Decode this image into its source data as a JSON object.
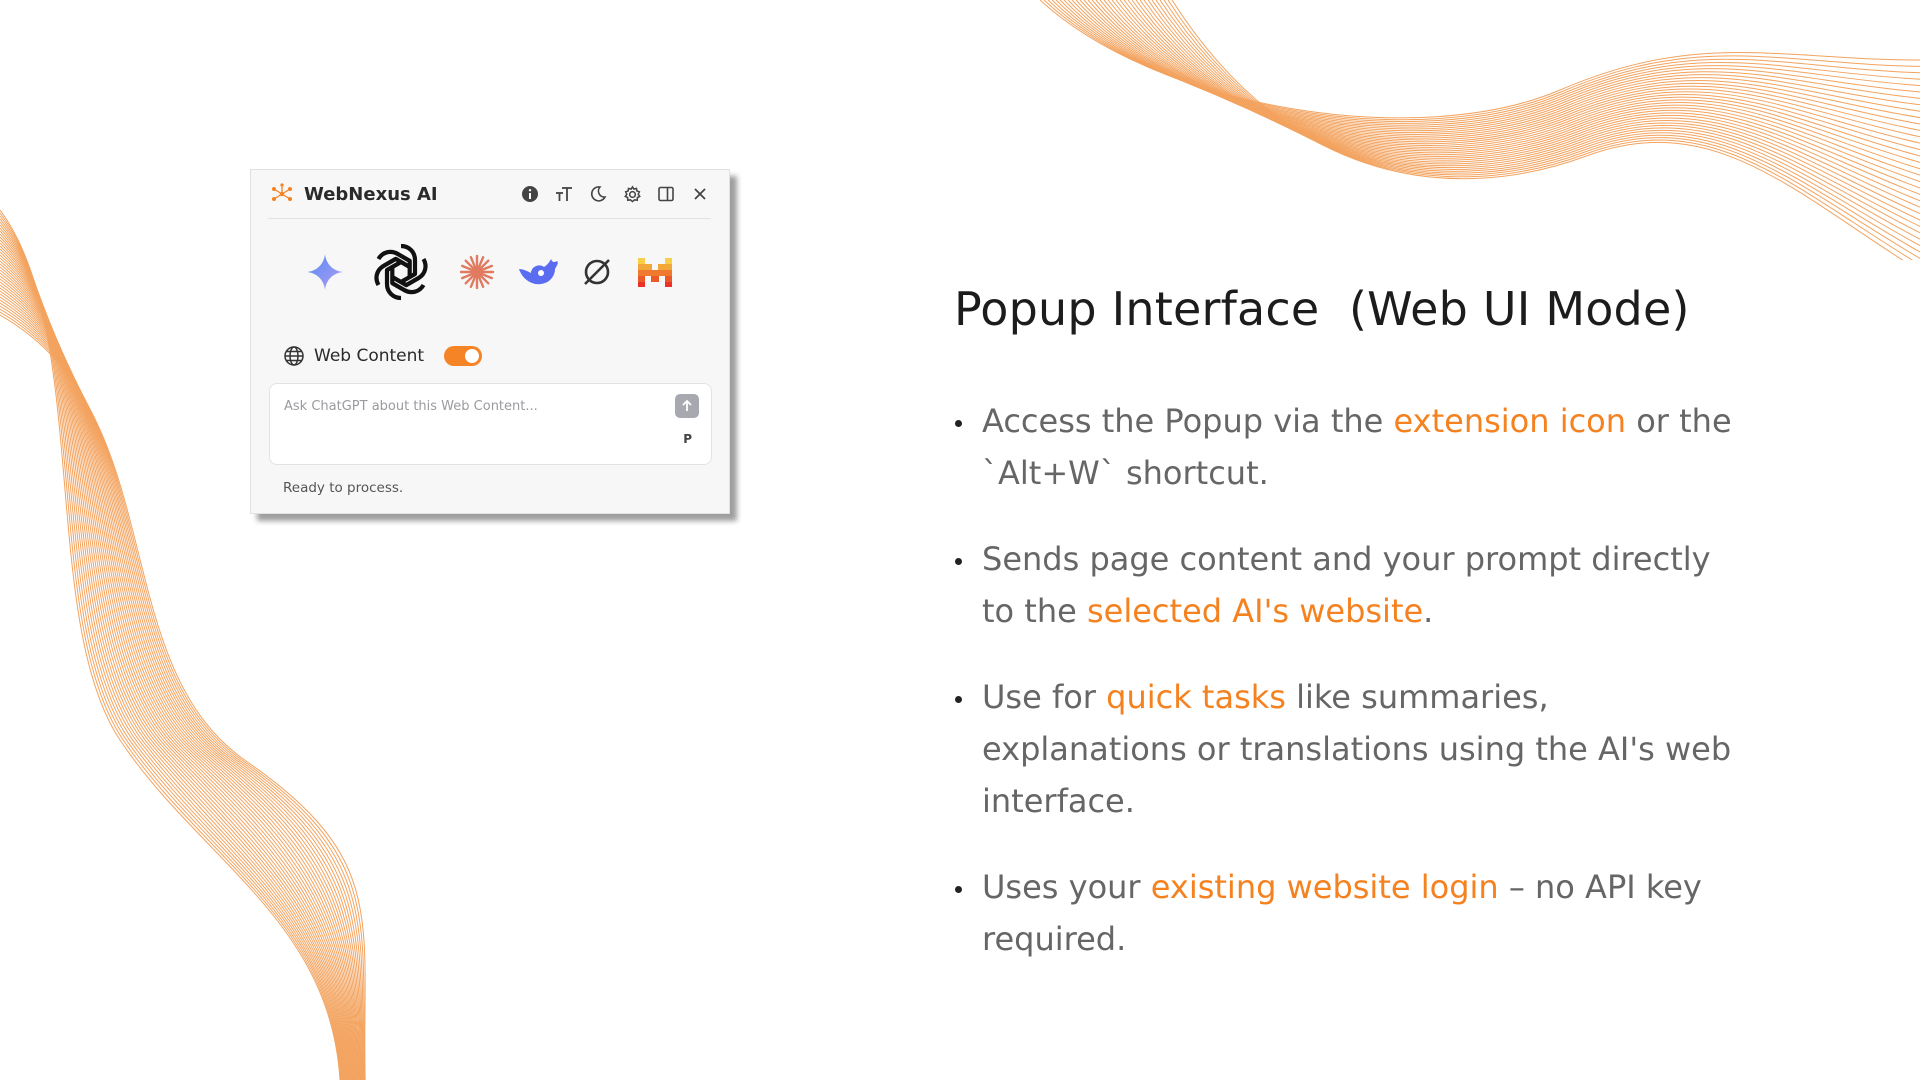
{
  "colors": {
    "accent": "#f58220",
    "toggle_on": "#f58427",
    "text_dark": "#1c1c1c",
    "text_body": "#666666",
    "deco_lines": "#f3a35f"
  },
  "popup": {
    "title": "WebNexus AI",
    "header_icons": [
      "info-icon",
      "text-size-icon",
      "moon-icon",
      "gear-icon",
      "sidebar-icon",
      "close-icon"
    ],
    "ai_models": [
      "gemini-icon",
      "chatgpt-icon",
      "claude-icon",
      "deepseek-icon",
      "grok-icon",
      "mistral-icon"
    ],
    "selected_model": "chatgpt-icon",
    "web_content_label": "Web Content",
    "web_content_enabled": true,
    "prompt_placeholder": "Ask ChatGPT about this Web Content...",
    "prompt_marker": "P",
    "status": "Ready to process."
  },
  "slide": {
    "title": "Popup Interface  (Web UI Mode)",
    "bullets": [
      [
        {
          "text": "Access the Popup via the ",
          "hl": false
        },
        {
          "text": "extension icon",
          "hl": true
        },
        {
          "text": " or the `Alt+W` shortcut.",
          "hl": false
        }
      ],
      [
        {
          "text": "Sends page content and your prompt directly to the ",
          "hl": false
        },
        {
          "text": "selected AI's website",
          "hl": true
        },
        {
          "text": ".",
          "hl": false
        }
      ],
      [
        {
          "text": "Use for ",
          "hl": false
        },
        {
          "text": "quick tasks",
          "hl": true
        },
        {
          "text": " like summaries, explanations or translations using the AI's web interface.",
          "hl": false
        }
      ],
      [
        {
          "text": "Uses your ",
          "hl": false
        },
        {
          "text": "existing website login",
          "hl": true
        },
        {
          "text": " – no API key required.",
          "hl": false
        }
      ]
    ]
  }
}
